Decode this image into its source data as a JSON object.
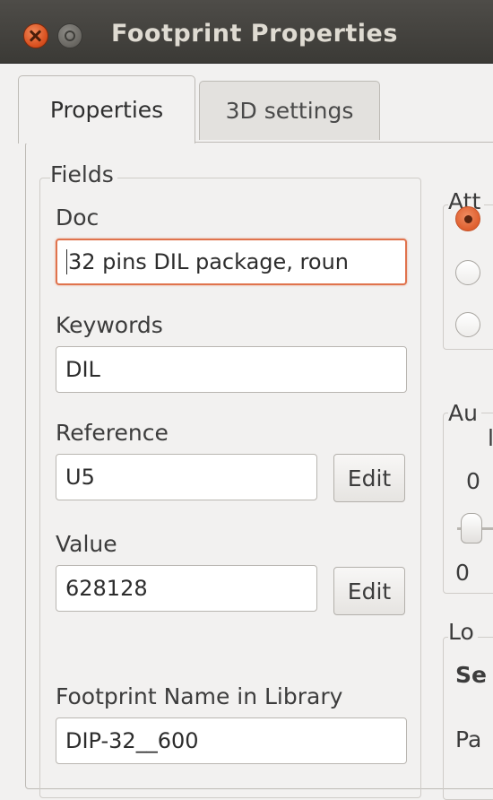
{
  "window": {
    "title": "Footprint Properties"
  },
  "tabs": [
    {
      "label": "Properties",
      "active": true
    },
    {
      "label": "3D settings",
      "active": false
    }
  ],
  "fields_group": {
    "title": "Fields",
    "doc": {
      "label": "Doc",
      "value": "32 pins DIL package, roun"
    },
    "keywords": {
      "label": "Keywords",
      "value": "DIL"
    },
    "reference": {
      "label": "Reference",
      "value": "U5",
      "edit_label": "Edit"
    },
    "value": {
      "label": "Value",
      "value": "628128",
      "edit_label": "Edit"
    },
    "footprint_name": {
      "label": "Footprint Name in Library",
      "value": "DIP-32__600"
    }
  },
  "attributes_group": {
    "title": "Att",
    "radios": [
      {
        "checked": true
      },
      {
        "checked": false
      },
      {
        "checked": false
      }
    ]
  },
  "autoplace_group": {
    "title": "Au",
    "row_label_cut": "l",
    "slider_top_value": "0",
    "slider_bottom_value": "0"
  },
  "local_group": {
    "title": "Lo",
    "setting_label_cut": "Se",
    "pad_label_cut": "Pa"
  },
  "colors": {
    "titlebar": "#3b3a36",
    "accent": "#df5f2e",
    "window_bg": "#f2f1f0"
  }
}
